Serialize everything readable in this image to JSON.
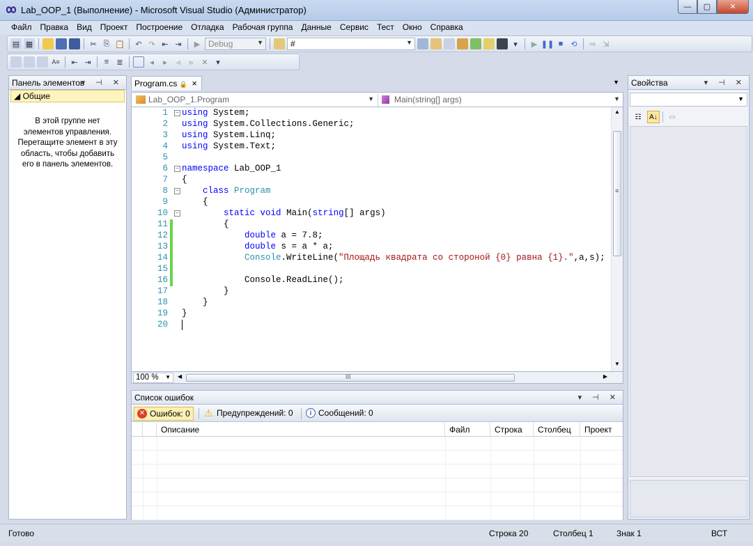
{
  "window": {
    "title": "Lab_OOP_1 (Выполнение) - Microsoft Visual Studio (Администратор)",
    "minimize": "—",
    "maximize": "▢",
    "close": "✕"
  },
  "menu": [
    "Файл",
    "Правка",
    "Вид",
    "Проект",
    "Построение",
    "Отладка",
    "Рабочая группа",
    "Данные",
    "Сервис",
    "Тест",
    "Окно",
    "Справка"
  ],
  "toolbar": {
    "config": "Debug",
    "find_value": "#"
  },
  "toolbox": {
    "title": "Панель элементов",
    "group": "◢ Общие",
    "empty_message": "В этой группе нет элементов управления. Перетащите элемент в эту область, чтобы добавить его в панель элементов."
  },
  "editor": {
    "tab_label": "Program.cs",
    "tab_close": "×",
    "nav_class": "Lab_OOP_1.Program",
    "nav_member": "Main(string[] args)",
    "zoom": "100 %",
    "hscroll_grip": "III",
    "vscroll_grip": "≡",
    "lines": [
      {
        "n": "1",
        "fold": "−",
        "chg": false,
        "html": "<span class=\"kw\">using</span> System;"
      },
      {
        "n": "2",
        "fold": "",
        "chg": false,
        "html": "<span class=\"kw\">using</span> System.Collections.Generic;"
      },
      {
        "n": "3",
        "fold": "",
        "chg": false,
        "html": "<span class=\"kw\">using</span> System.Linq;"
      },
      {
        "n": "4",
        "fold": "",
        "chg": false,
        "html": "<span class=\"kw\">using</span> System.Text;"
      },
      {
        "n": "5",
        "fold": "",
        "chg": false,
        "html": ""
      },
      {
        "n": "6",
        "fold": "−",
        "chg": false,
        "html": "<span class=\"kw\">namespace</span> Lab_OOP_1"
      },
      {
        "n": "7",
        "fold": "",
        "chg": false,
        "html": "{"
      },
      {
        "n": "8",
        "fold": "−",
        "chg": false,
        "html": "    <span class=\"kw\">class</span> <span class=\"ty\">Program</span>"
      },
      {
        "n": "9",
        "fold": "",
        "chg": false,
        "html": "    {"
      },
      {
        "n": "10",
        "fold": "−",
        "chg": false,
        "html": "        <span class=\"kw\">static</span> <span class=\"kw\">void</span> Main(<span class=\"kw\">string</span>[] args)"
      },
      {
        "n": "11",
        "fold": "",
        "chg": true,
        "html": "        {"
      },
      {
        "n": "12",
        "fold": "",
        "chg": true,
        "html": "            <span class=\"kw\">double</span> a = 7.8;"
      },
      {
        "n": "13",
        "fold": "",
        "chg": true,
        "html": "            <span class=\"kw\">double</span> s = a * a;"
      },
      {
        "n": "14",
        "fold": "",
        "chg": true,
        "html": "            <span class=\"ty\">Console</span>.WriteLine(<span class=\"st\">\"Площадь квадрата со стороной {0} равна {1}.\"</span>,a,s);"
      },
      {
        "n": "15",
        "fold": "",
        "chg": true,
        "html": ""
      },
      {
        "n": "16",
        "fold": "",
        "chg": true,
        "html": "            Console.ReadLine();"
      },
      {
        "n": "17",
        "fold": "",
        "chg": false,
        "html": "        }"
      },
      {
        "n": "18",
        "fold": "",
        "chg": false,
        "html": "    }"
      },
      {
        "n": "19",
        "fold": "",
        "chg": false,
        "html": "}"
      },
      {
        "n": "20",
        "fold": "",
        "chg": false,
        "html": ""
      }
    ]
  },
  "error_list": {
    "title": "Список ошибок",
    "errors": "Ошибок: 0",
    "warnings": "Предупреждений: 0",
    "messages": "Сообщений: 0",
    "columns": [
      "Описание",
      "Файл",
      "Строка",
      "Столбец",
      "Проект"
    ]
  },
  "properties": {
    "title": "Свойства"
  },
  "status": {
    "ready": "Готово",
    "line": "Строка 20",
    "col": "Столбец 1",
    "char": "Знак 1",
    "mode": "ВСТ"
  },
  "panel_controls": "▾ ⊣ ✕"
}
